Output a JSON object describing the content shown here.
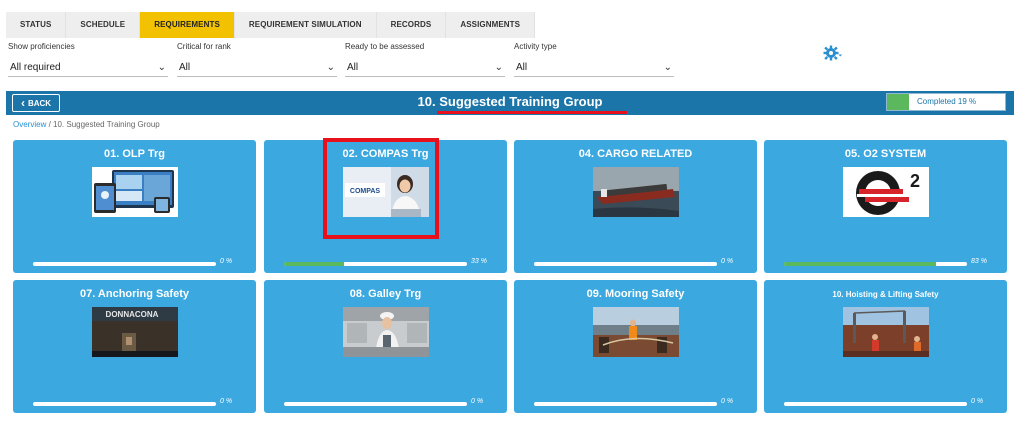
{
  "tabs": [
    "STATUS",
    "SCHEDULE",
    "REQUIREMENTS",
    "REQUIREMENT SIMULATION",
    "RECORDS",
    "ASSIGNMENTS"
  ],
  "active_tab": "REQUIREMENTS",
  "filters": [
    {
      "label": "Show proficiencies",
      "value": "All required"
    },
    {
      "label": "Critical for rank",
      "value": "All"
    },
    {
      "label": "Ready to be assessed",
      "value": "All"
    },
    {
      "label": "Activity type",
      "value": "All"
    }
  ],
  "header": {
    "back_label": "BACK",
    "title": "10. Suggested Training Group",
    "completed_label": "Completed 19 %",
    "completed_fraction": 0.19
  },
  "breadcrumb": {
    "root": "Overview",
    "separator": " / ",
    "current": "10. Suggested Training Group"
  },
  "cards": [
    {
      "title": "01. OLP Trg",
      "progress": 0,
      "pct_label": "0 %",
      "icon": "olp-devices-thumbnail"
    },
    {
      "title": "02. COMPAS Trg",
      "progress": 0.33,
      "pct_label": "33 %",
      "icon": "compas-operator-thumbnail",
      "thumb_text": "COMPAS"
    },
    {
      "title": "04. CARGO RELATED",
      "progress": 0,
      "pct_label": "0 %",
      "icon": "cargo-ship-thumbnail"
    },
    {
      "title": "05. O2 SYSTEM",
      "progress": 0.83,
      "pct_label": "83 %",
      "icon": "o2-logo-thumbnail",
      "thumb_text": "2"
    },
    {
      "title": "07. Anchoring Safety",
      "progress": 0,
      "pct_label": "0 %",
      "icon": "anchoring-thumbnail",
      "thumb_text": "DONNACONA"
    },
    {
      "title": "08. Galley Trg",
      "progress": 0,
      "pct_label": "0 %",
      "icon": "galley-thumbnail"
    },
    {
      "title": "09. Mooring Safety",
      "progress": 0,
      "pct_label": "0 %",
      "icon": "mooring-thumbnail"
    },
    {
      "title": "10. Hoisting & Lifting Safety",
      "progress": 0,
      "pct_label": "0 %",
      "icon": "hoisting-thumbnail"
    }
  ],
  "colors": {
    "accent": "#f2c200",
    "header": "#1b75a8",
    "card": "#3ba8e0",
    "progress": "#5cb85c",
    "highlight": "#e8101a"
  }
}
